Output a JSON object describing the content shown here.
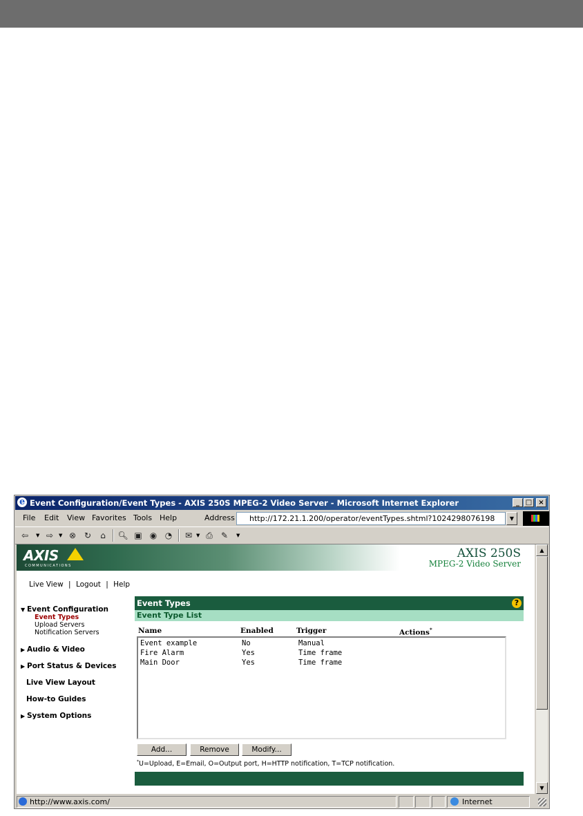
{
  "window": {
    "title": "Event Configuration/Event Types - AXIS 250S MPEG-2 Video Server - Microsoft Internet Explorer",
    "controls": {
      "minimize": "_",
      "maximize": "□",
      "close": "×"
    }
  },
  "menu": {
    "items": [
      "File",
      "Edit",
      "View",
      "Favorites",
      "Tools",
      "Help"
    ],
    "address_label": "Address",
    "address_value": "http://172.21.1.200/operator/eventTypes.shtml?1024298076198"
  },
  "toolbar": {
    "icons": [
      "back-icon",
      "forward-icon",
      "stop-icon",
      "refresh-icon",
      "home-icon",
      "search-icon",
      "favorites-icon",
      "media-icon",
      "history-icon",
      "mail-icon",
      "print-icon",
      "edit-icon"
    ]
  },
  "header": {
    "logo": "AXIS",
    "logo_sub": "COMMUNICATIONS",
    "product": "AXIS 250S",
    "product_sub": "MPEG-2 Video Server"
  },
  "top_links": [
    "Live View",
    "|",
    "Logout",
    "|",
    "Help"
  ],
  "nav": {
    "event_configuration": "Event Configuration",
    "sub_items": [
      "Event Types",
      "Upload Servers",
      "Notification Servers"
    ],
    "audio_video": "Audio & Video",
    "port_status": "Port Status & Devices",
    "live_view_layout": "Live View Layout",
    "howto": "How-to Guides",
    "system_options": "System Options"
  },
  "panel": {
    "title": "Event Types",
    "help": "?",
    "subtitle": "Event Type List",
    "columns": [
      "Name",
      "Enabled",
      "Trigger",
      "Actions"
    ],
    "actions_mark": "*",
    "rows": [
      {
        "name": "Event example",
        "enabled": "No",
        "trigger": "Manual"
      },
      {
        "name": "Fire Alarm",
        "enabled": "Yes",
        "trigger": "Time frame"
      },
      {
        "name": "Main Door",
        "enabled": "Yes",
        "trigger": "Time frame"
      }
    ],
    "buttons": {
      "add": "Add...",
      "remove": "Remove",
      "modify": "Modify..."
    },
    "footnote_mark": "*",
    "footnote": "U=Upload, E=Email, O=Output port, H=HTTP notification, T=TCP notification."
  },
  "status": {
    "url": "http://www.axis.com/",
    "zone": "Internet"
  },
  "colors": {
    "accent_dark": "#1a5c3e",
    "accent_light": "#a6dec3",
    "title_bar": "#0a246a"
  }
}
